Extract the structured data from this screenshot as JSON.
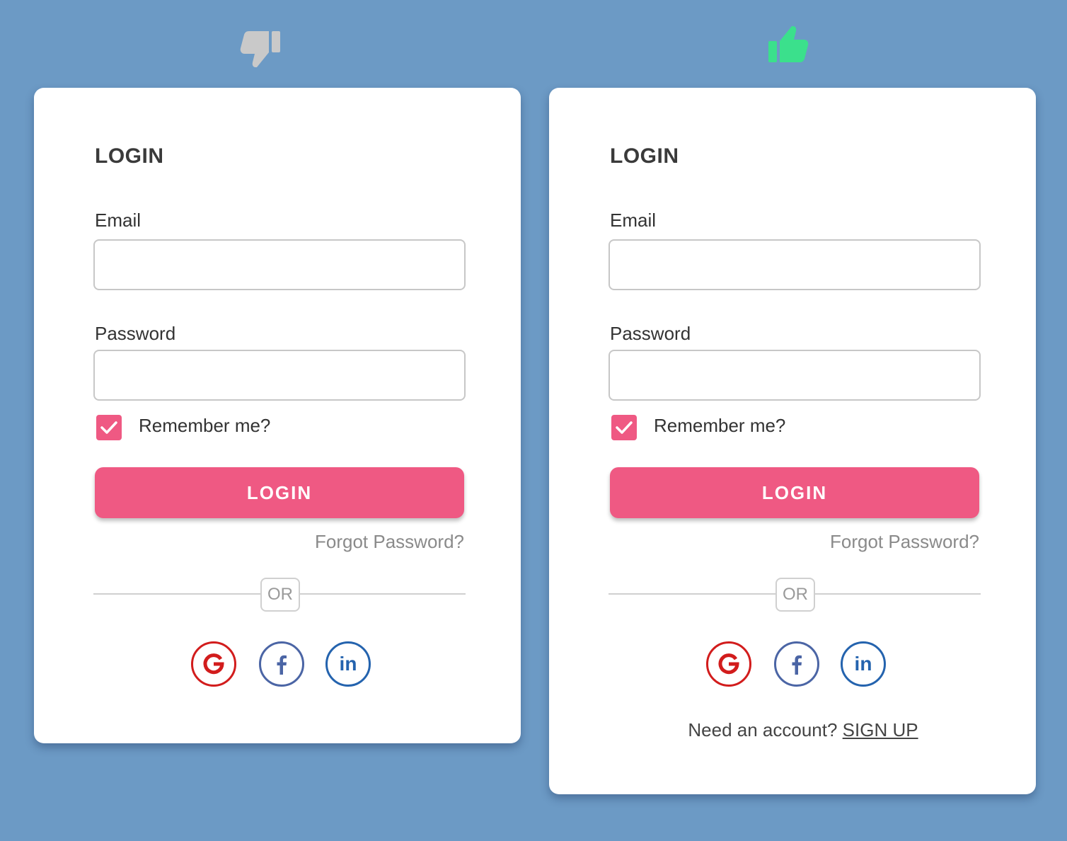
{
  "colors": {
    "background": "#6c9ac5",
    "accent": "#ef5983",
    "thumbs_down": "#c9c9c9",
    "thumbs_up": "#3be08c",
    "google": "#d21c1c",
    "facebook": "#4b65a5",
    "linkedin": "#2463ae"
  },
  "icons": {
    "left_header": "thumbs-down-icon",
    "right_header": "thumbs-up-icon",
    "checkbox": "checkmark-icon",
    "social": [
      "google-icon",
      "facebook-icon",
      "linkedin-icon"
    ]
  },
  "left": {
    "title": "LOGIN",
    "email_label": "Email",
    "email_value": "",
    "password_label": "Password",
    "password_value": "",
    "remember_label": "Remember me?",
    "remember_checked": true,
    "login_button": "LOGIN",
    "forgot_link": "Forgot Password?",
    "or_text": "OR",
    "linkedin_text": "in"
  },
  "right": {
    "title": "LOGIN",
    "email_label": "Email",
    "email_value": "",
    "password_label": "Password",
    "password_value": "",
    "remember_label": "Remember me?",
    "remember_checked": true,
    "login_button": "LOGIN",
    "forgot_link": "Forgot Password?",
    "or_text": "OR",
    "linkedin_text": "in",
    "signup_prompt": "Need an account?",
    "signup_link": "SIGN UP"
  }
}
